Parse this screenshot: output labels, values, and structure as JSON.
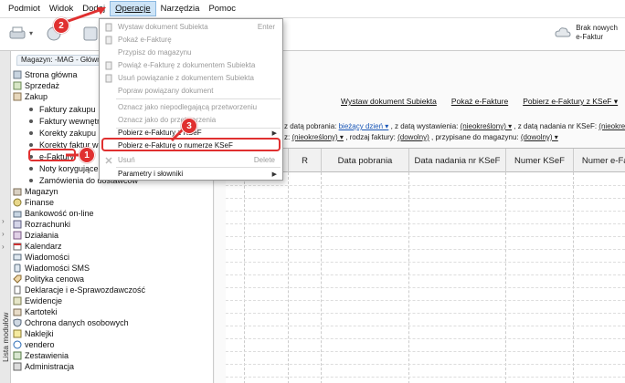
{
  "menubar": {
    "items": [
      "Podmiot",
      "Widok",
      "Dodaj",
      "Operacje",
      "Narzędzia",
      "Pomoc"
    ]
  },
  "toolbar": {
    "right_info": [
      "Brak nowych",
      "e-Faktur"
    ]
  },
  "left_panel": {
    "vertical_tab": "Lista modułów",
    "mag_tab": "Magazyn: -MAG - Główny",
    "tree": [
      {
        "label": "Strona główna"
      },
      {
        "label": "Sprzedaż"
      },
      {
        "label": "Zakup"
      },
      {
        "label": "Faktury zakupu"
      },
      {
        "label": "Faktury wewnętrzne"
      },
      {
        "label": "Korekty zakupu"
      },
      {
        "label": "Korekty faktur wewnętrznych"
      },
      {
        "label": "e-Faktury"
      },
      {
        "label": "Noty korygujące"
      },
      {
        "label": "Zamówienia do dostawców"
      },
      {
        "label": "Magazyn"
      },
      {
        "label": "Finanse"
      },
      {
        "label": "Bankowość on-line"
      },
      {
        "label": "Rozrachunki"
      },
      {
        "label": "Działania"
      },
      {
        "label": "Kalendarz"
      },
      {
        "label": "Wiadomości"
      },
      {
        "label": "Wiadomości SMS"
      },
      {
        "label": "Polityka cenowa"
      },
      {
        "label": "Deklaracje i e-Sprawozdawczość"
      },
      {
        "label": "Ewidencje"
      },
      {
        "label": "Kartoteki"
      },
      {
        "label": "Ochrona danych osobowych"
      },
      {
        "label": "Naklejki"
      },
      {
        "label": "vendero"
      },
      {
        "label": "Zestawienia"
      },
      {
        "label": "Administracja"
      }
    ]
  },
  "main": {
    "links": [
      "Wystaw dokument Subiekta",
      "Pokaż e-Fakture",
      "Pobierz e-Faktury z KSeF ▾"
    ],
    "filter1": {
      "t1": "z datą pobrania:",
      "v1": "bieżący dzień ▾",
      "t2": ", z datą wystawienia:",
      "v2": "(nieokreślony) ▾",
      "t3": ", z datą nadania nr KSeF:",
      "v3": "(nieokreślony)"
    },
    "filter2": {
      "t0": "z:",
      "v1": "(nieokreślony) ▾",
      "t1": ", rodzaj faktury:",
      "v2": "(dowolny)",
      "t2": ", przypisane do magazynu:",
      "v3": "(dowolny) ▾"
    },
    "columns": [
      "R",
      "Data pobrania",
      "Data nadania nr KSeF",
      "Numer KSeF",
      "Numer e-Faktury"
    ]
  },
  "dropdown": {
    "items": [
      {
        "label": "Wystaw dokument Subiekta",
        "shortcut": "Enter",
        "disabled": true
      },
      {
        "label": "Pokaż e-Fakturę",
        "disabled": true
      },
      {
        "label": "Przypisz do magazynu",
        "disabled": true
      },
      {
        "label": "Powiąż e-Fakturę z dokumentem Subiekta",
        "disabled": true
      },
      {
        "label": "Usuń powiązanie z dokumentem Subiekta",
        "disabled": true
      },
      {
        "label": "Popraw powiązany dokument",
        "disabled": true
      },
      {
        "label": "Oznacz jako niepodlegającą przetworzeniu",
        "disabled": true
      },
      {
        "label": "Oznacz jako do przetworzenia",
        "disabled": true
      },
      {
        "label": "Pobierz e-Faktury z KSeF",
        "disabled": false,
        "submenu": true
      },
      {
        "label": "Pobierz e-Fakturę o numerze KSeF",
        "disabled": false
      },
      {
        "label": "Usuń",
        "shortcut": "Delete",
        "disabled": true
      },
      {
        "label": "Parametry i słowniki",
        "disabled": false,
        "submenu": true
      }
    ]
  },
  "callouts": [
    "1",
    "2",
    "3"
  ],
  "colors": {
    "accent_red": "#e03030",
    "menu_highlight": "#cde4f7",
    "link_blue": "#1a57b7"
  }
}
